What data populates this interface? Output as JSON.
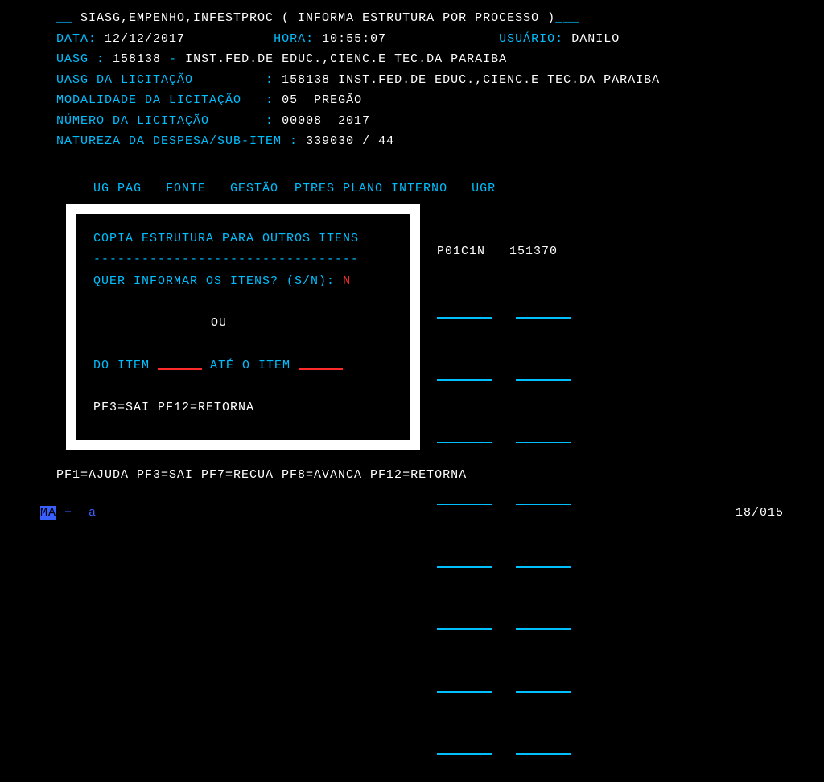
{
  "header": {
    "breadcrumb_left": "__ ",
    "breadcrumb": "SIASG,EMPENHO,INFESTPROC ( INFORMA ESTRUTURA POR PROCESSO )",
    "breadcrumb_right": "___",
    "data_label": "DATA:",
    "data_value": "12/12/2017",
    "hora_label": "HORA:",
    "hora_value": "10:55:07",
    "usuario_label": "USUÁRIO:",
    "usuario_value": "DANILO",
    "uasg_label": "UASG :",
    "uasg_code": "158138",
    "uasg_dash": " - ",
    "uasg_name": "INST.FED.DE EDUC.,CIENC.E TEC.DA PARAIBA",
    "uasg_lic_label": "UASG DA LICITAÇÃO",
    "uasg_lic_sep": ":",
    "uasg_lic_value": "158138 INST.FED.DE EDUC.,CIENC.E TEC.DA PARAIBA",
    "mod_label": "MODALIDADE DA LICITAÇÃO",
    "mod_sep": ":",
    "mod_value": "05  PREGÃO",
    "num_label": "NÚMERO DA LICITAÇÃO",
    "num_sep": ":",
    "num_value": "00008  2017",
    "nat_label": "NATUREZA DA DESPESA/SUB-ITEM :",
    "nat_value": "339030 / 44"
  },
  "columns": {
    "header": "UG PAG   FONTE   GESTÃO  PTRES PLANO INTERNO   UGR"
  },
  "data_row": {
    "plano": "P01C1N",
    "ugr": "151370"
  },
  "popup": {
    "title": "COPIA ESTRUTURA PARA OUTROS ITENS",
    "divider": "---------------------------------",
    "prompt": "QUER INFORMAR OS ITENS? (S/N):",
    "answer": "N",
    "or": "OU",
    "from_label": "DO ITEM",
    "to_label": "ATÉ O ITEM",
    "fkeys": "PF3=SAI PF12=RETORNA"
  },
  "fkeys_main": "PF1=AJUDA PF3=SAI PF7=RECUA PF8=AVANCA PF12=RETORNA",
  "status": {
    "left_inv": "MA",
    "left_rest": " +  a",
    "right": "18/015"
  }
}
